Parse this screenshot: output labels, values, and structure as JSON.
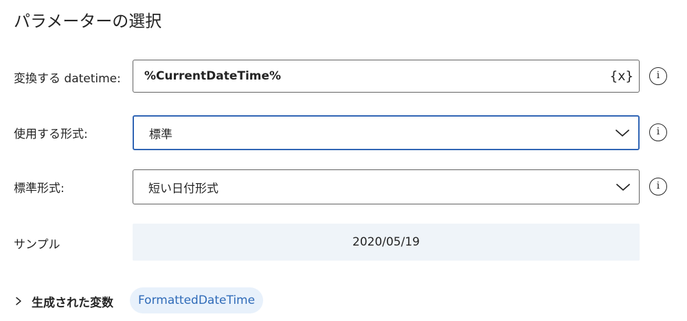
{
  "dialog": {
    "title": "パラメーターの選択"
  },
  "fields": {
    "datetime": {
      "label": "変換する datetime:",
      "value": "%CurrentDateTime%",
      "variable_icon": "{x}"
    },
    "format_type": {
      "label": "使用する形式:",
      "value": "標準"
    },
    "standard_format": {
      "label": "標準形式:",
      "value": "短い日付形式"
    },
    "sample": {
      "label": "サンプル",
      "value": "2020/05/19"
    }
  },
  "info_icon_glyph": "i",
  "generated_variables": {
    "label": "生成された変数",
    "chip": "FormattedDateTime"
  },
  "colors": {
    "focus_border": "#2f64b4",
    "sample_background": "#eff4f9",
    "chip_background": "#e8f1fb",
    "chip_text": "#2e6ab8"
  }
}
